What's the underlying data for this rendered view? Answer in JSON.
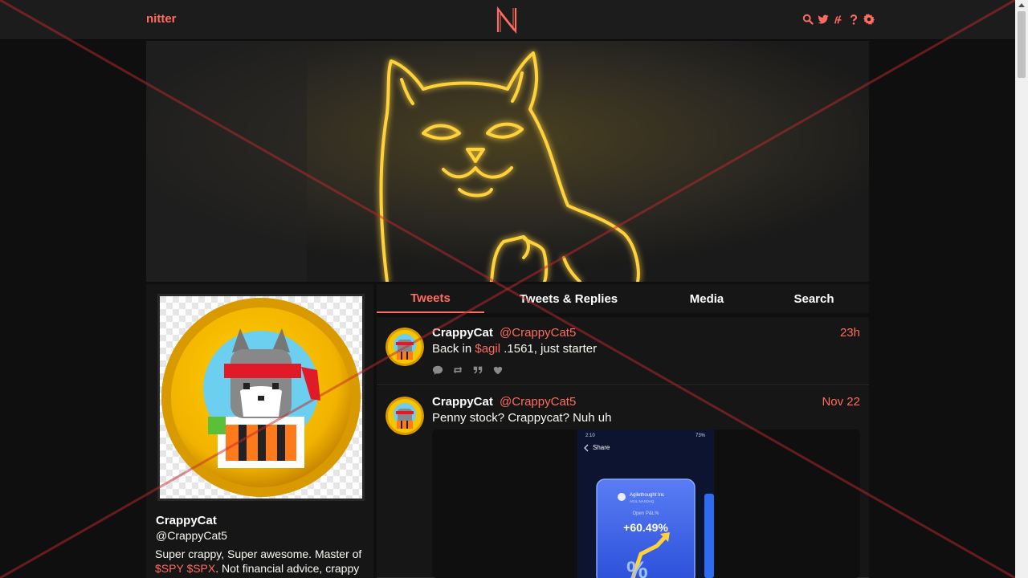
{
  "navbar": {
    "brand": "nitter",
    "logo_letter": "N",
    "icons": [
      "search-icon",
      "twitter-icon",
      "rss-icon",
      "help-icon",
      "gear-icon"
    ]
  },
  "profile": {
    "fullname": "CrappyCat",
    "username": "@CrappyCat5",
    "bio_text_1": "Super crappy, Super awesome. Master of ",
    "bio_link_1": "$SPY",
    "bio_link_2": "$SPX",
    "bio_text_2": ". Not financial advice, crappy"
  },
  "tabs": [
    {
      "label": "Tweets",
      "active": true
    },
    {
      "label": "Tweets & Replies",
      "active": false
    },
    {
      "label": "Media",
      "active": false
    },
    {
      "label": "Search",
      "active": false
    }
  ],
  "tweets": [
    {
      "fullname": "CrappyCat",
      "username": "@CrappyCat5",
      "date": "23h",
      "text_pre": "Back in ",
      "cashtag": "$agil",
      "text_post": " .1561, just starter"
    },
    {
      "fullname": "CrappyCat",
      "username": "@CrappyCat5",
      "date": "Nov 22",
      "text": "Penny stock? Crappycat? Nuh uh",
      "screenshot": {
        "status_time": "2:10",
        "status_right": "73%",
        "share_label": "Share",
        "company": "Agilethought Inc",
        "ticker": "AGIL NASDAQ",
        "pnl_label": "Open P&L%",
        "pnl_value": "+60.49%"
      }
    }
  ],
  "colors": {
    "accent": "#ff6c60",
    "background": "#0f0f0f",
    "card": "#161616",
    "navbar": "#1c1c1c",
    "neon": "#ffd23c"
  }
}
